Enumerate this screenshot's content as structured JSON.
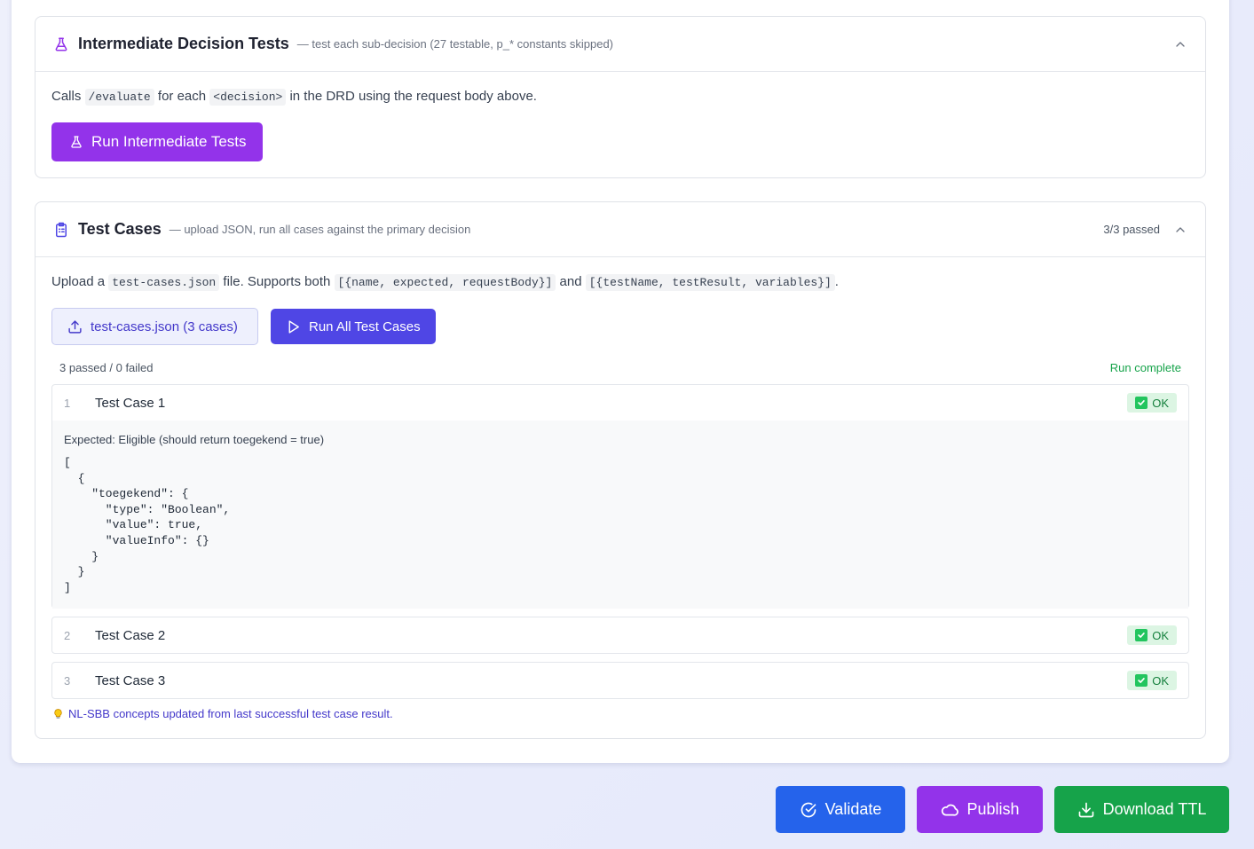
{
  "intermediate": {
    "title": "Intermediate Decision Tests",
    "subtitle": "— test each sub-decision (27 testable, p_* constants skipped)",
    "desc_prefix": "Calls",
    "desc_code1": "/evaluate",
    "desc_mid": "for each",
    "desc_code2": "<decision>",
    "desc_suffix": "in the DRD using the request body above.",
    "run_button": "Run Intermediate Tests"
  },
  "test_cases": {
    "title": "Test Cases",
    "subtitle": "— upload JSON, run all cases against the primary decision",
    "passed_count": "3/3 passed",
    "desc_prefix": "Upload a",
    "desc_code1": "test-cases.json",
    "desc_mid": "file. Supports both",
    "desc_code2": "[{name, expected, requestBody}]",
    "desc_and": "and",
    "desc_code3": "[{testName, testResult, variables}]",
    "desc_end": ".",
    "upload_button": "test-cases.json (3 cases)",
    "run_all_button": "Run All Test Cases",
    "summary": "3 passed / 0 failed",
    "status": "Run complete",
    "cases": [
      {
        "num": "1",
        "name": "Test Case 1",
        "result": "OK",
        "expected": "Expected: Eligible (should return toegekend = true)",
        "json": "[\n  {\n    \"toegekend\": {\n      \"type\": \"Boolean\",\n      \"value\": true,\n      \"valueInfo\": {}\n    }\n  }\n]"
      },
      {
        "num": "2",
        "name": "Test Case 2",
        "result": "OK"
      },
      {
        "num": "3",
        "name": "Test Case 3",
        "result": "OK"
      }
    ],
    "note_icon": "lightbulb-icon",
    "note": "NL-SBB concepts updated from last successful test case result."
  },
  "actions": {
    "validate": "Validate",
    "publish": "Publish",
    "download": "Download TTL"
  },
  "colors": {
    "purple": "#9333ea",
    "indigo": "#4f46e5",
    "validate_blue": "#2563eb",
    "download_green": "#16a34a",
    "ok_green": "#15803d"
  }
}
